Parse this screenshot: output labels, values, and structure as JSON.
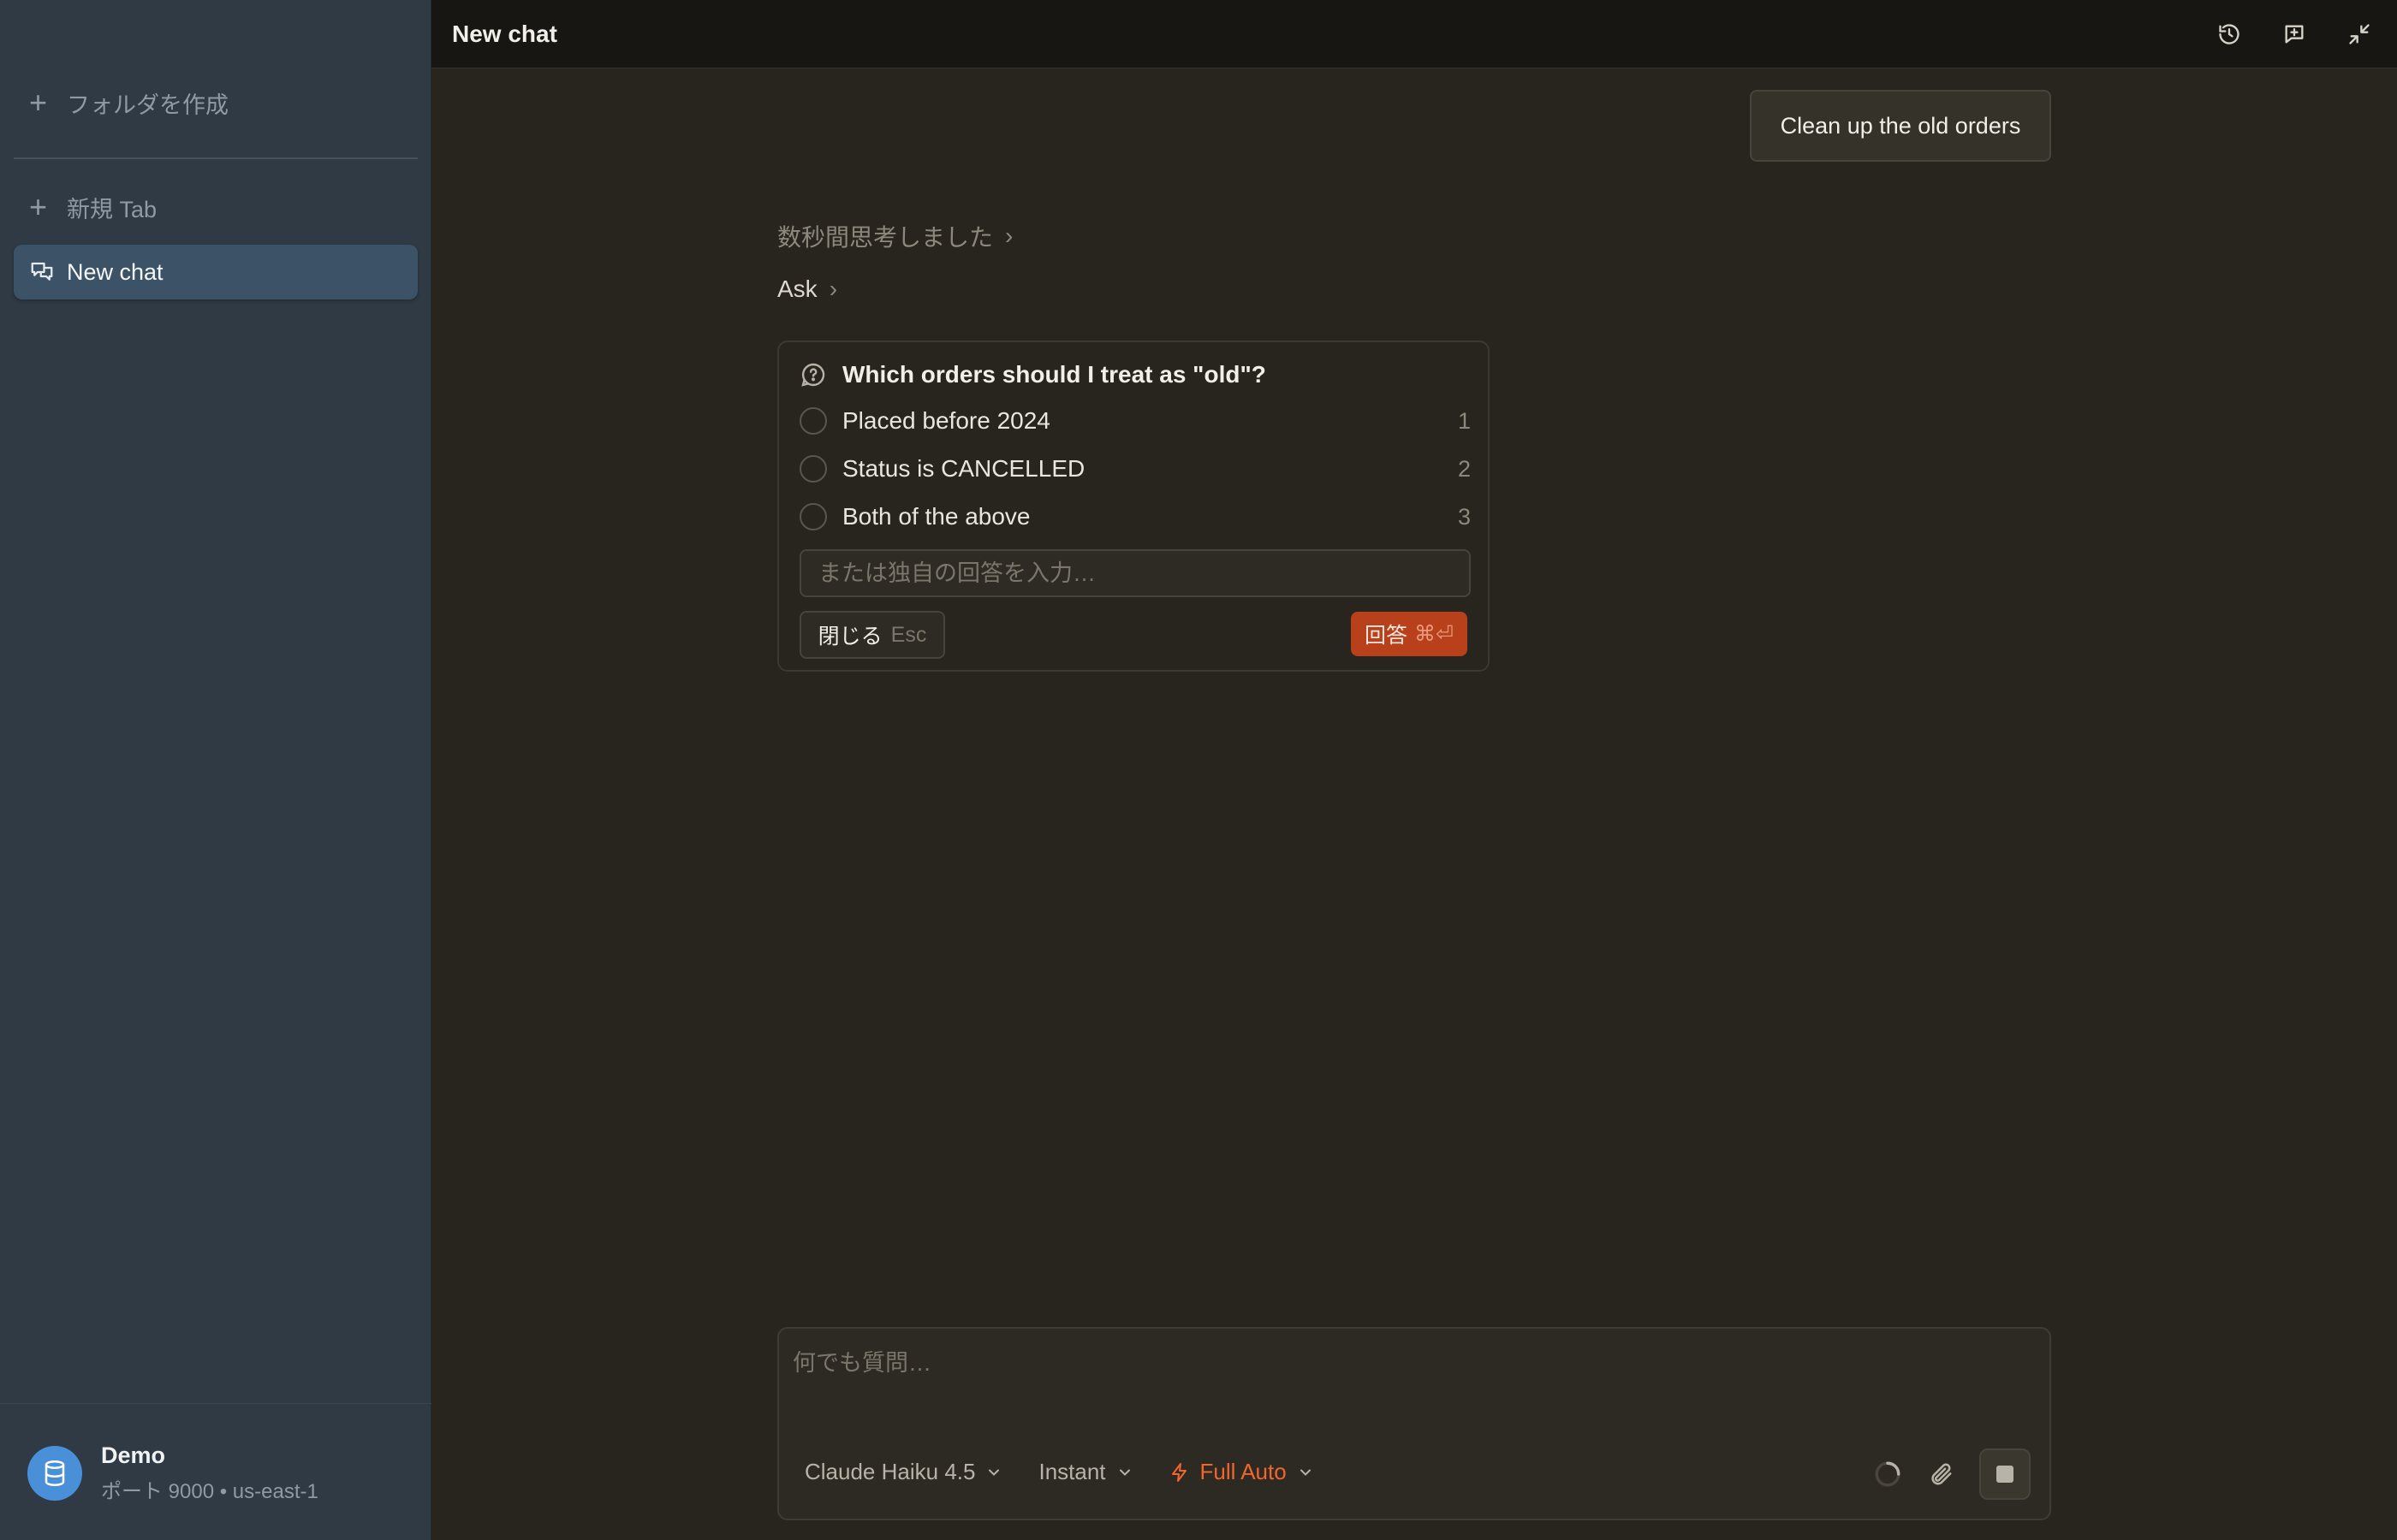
{
  "sidebar": {
    "create_folder": "フォルダを作成",
    "new_tab": "新規 Tab",
    "active_chat": "New chat",
    "footer": {
      "name": "Demo",
      "subtitle": "ポート 9000 • us-east-1"
    }
  },
  "topbar": {
    "title": "New chat",
    "icons": [
      "history-icon",
      "new-chat-icon",
      "collapse-icon"
    ]
  },
  "conversation": {
    "user_message": "Clean up the old orders",
    "thought_label": "数秒間思考しました",
    "ask_label": "Ask"
  },
  "question": {
    "text": "Which orders should I treat as \"old\"?",
    "options": [
      {
        "label": "Placed before 2024",
        "num": "1"
      },
      {
        "label": "Status is CANCELLED",
        "num": "2"
      },
      {
        "label": "Both of the above",
        "num": "3"
      }
    ],
    "custom_placeholder": "または独自の回答を入力…",
    "close_label": "閉じる",
    "close_kbd": "Esc",
    "answer_label": "回答",
    "answer_kbd": "⌘⏎"
  },
  "composer": {
    "placeholder": "何でも質問…",
    "model": "Claude Haiku 4.5",
    "mode": "Instant",
    "autonomy": "Full Auto"
  },
  "colors": {
    "accent": "#b8401b",
    "auto_orange": "#f0662e",
    "sidebar_bg": "#2f3a45",
    "main_bg": "#28251e"
  }
}
